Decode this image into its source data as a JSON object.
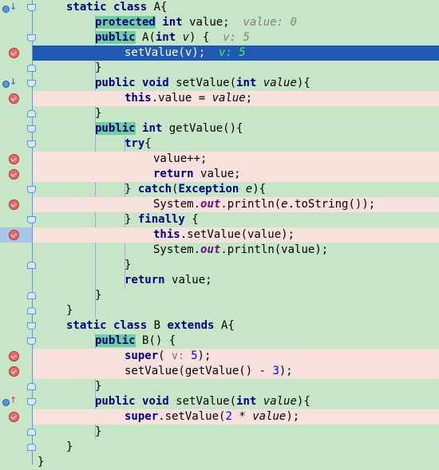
{
  "lines": [
    [
      "",
      "static class A{"
    ],
    [
      "",
      "protected int value;  value: 0"
    ],
    [
      "",
      "public A(int v) {  v: 5"
    ],
    [
      "",
      "setValue(v);  v: 5"
    ],
    [
      "",
      "}"
    ],
    [
      "",
      "public void setValue(int value){"
    ],
    [
      "",
      "this.value = value;"
    ],
    [
      "",
      "}"
    ],
    [
      "",
      "public int getValue(){"
    ],
    [
      "",
      "try{"
    ],
    [
      "",
      "value++;"
    ],
    [
      "",
      "return value;"
    ],
    [
      "",
      "} catch(Exception e){"
    ],
    [
      "",
      "System.out.println(e.toString());"
    ],
    [
      "",
      "} finally {"
    ],
    [
      "",
      "this.setValue(value);"
    ],
    [
      "",
      "System.out.println(value);"
    ],
    [
      "",
      "}"
    ],
    [
      "",
      "return value;"
    ],
    [
      "",
      "}"
    ],
    [
      "",
      "}"
    ],
    [
      "",
      "static class B extends A{"
    ],
    [
      "",
      "public B() {"
    ],
    [
      "",
      "super( v: 5);"
    ],
    [
      "",
      "setValue(getValue() - 3);"
    ],
    [
      "",
      "}"
    ],
    [
      "",
      "public void setValue(int value){"
    ],
    [
      "",
      "super.setValue(2 * value);"
    ],
    [
      "",
      "}"
    ],
    [
      "",
      "}"
    ],
    [
      "",
      "}"
    ]
  ],
  "tokens": {
    "static": "static",
    "class": "class",
    "A": "A{",
    "B": "B",
    "extends": "extends",
    "A2": "A{",
    "protected": "protected",
    "int": "int",
    "value_decl": "value;",
    "public": "public",
    "void": "void",
    "this": "this",
    "try": "try",
    "return": "return",
    "catch": "catch",
    "Exception": "Exception",
    "finally": "finally",
    "super": "super",
    "System": "System.",
    "out": "out",
    "println_e": ".println(",
    "e": "e",
    "toString": ".toString());",
    "println_v": ".println(value);",
    "hint_value0": "value: 0",
    "hint_v5": "v: 5",
    "hint_v5_cur": "v: 5",
    "param_v": "v:",
    "five": "5",
    "three": "3",
    "two": "2",
    "A_ctor": "A(",
    "v_param": "v",
    "setValue_call": "setValue(v);",
    "setValue_decl": "setValue(",
    "value_param": "value",
    "this_value": ".value = ",
    "value_it": "value",
    "getValue": "getValue(){",
    "value_pp": "value++;",
    "ret_value": "value;",
    "setValue_value": ".setValue(value);",
    "B_ctor": "B() {",
    "setValue_getValue": "setValue(getValue() - ",
    "super_setValue": ".setValue(",
    "times": " * "
  }
}
